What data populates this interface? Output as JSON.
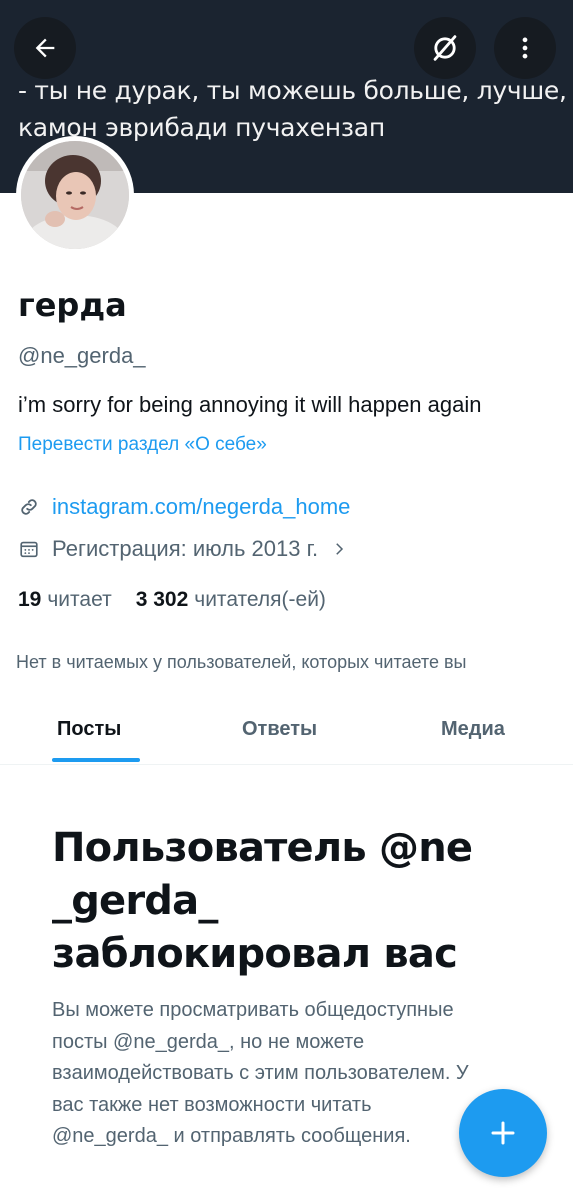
{
  "banner": {
    "line1": "- ты не дурак, ты можешь больше, лучше,",
    "line2": "камон эврибади пучахензап"
  },
  "toolbar": {
    "back_icon": "arrow-left-icon",
    "notify_icon": "bell-off-icon",
    "more_icon": "more-vertical-icon"
  },
  "profile": {
    "name": "герда",
    "handle": "@ne_gerda_",
    "bio": "i’m sorry for being annoying it will happen again",
    "translate_label": "Перевести раздел «О себе»",
    "link": "instagram.com/negerda_home",
    "joined": "Регистрация: июль 2013 г.",
    "following_count": "19",
    "following_label": "читает",
    "followers_count": "3 302",
    "followers_label": "читателя(-ей)",
    "mutuals_notice": "Нет в читаемых у пользователей, которых читаете вы"
  },
  "tabs": [
    {
      "label": "Посты",
      "active": true
    },
    {
      "label": "Ответы",
      "active": false
    },
    {
      "label": "Медиа",
      "active": false
    }
  ],
  "blocked": {
    "title": "Пользователь @ne _gerda_ заблокировал вас",
    "body": "Вы можете просматривать общедоступные посты @ne_gerda_, но не можете взаимодействовать с этим пользователем. У вас также нет возможности читать @ne_gerda_ и отправлять сообщения."
  },
  "fab": {
    "icon": "plus-icon"
  },
  "colors": {
    "accent": "#1d9bf0",
    "banner": "#1b2430",
    "muted": "#536471"
  }
}
